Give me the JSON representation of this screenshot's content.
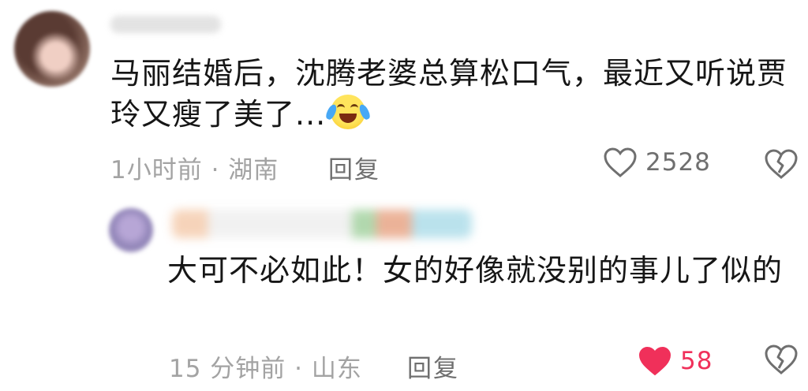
{
  "comments": [
    {
      "text": "马丽结婚后，沈腾老婆总算松口气，最近又听说贾玲又瘦了美了...",
      "emoji": "crying-laughing-emoji",
      "meta": "1小时前 · 湖南",
      "reply_label": "回复",
      "like_count": "2528",
      "liked": false
    },
    {
      "text": "大可不必如此！女的好像就没别的事儿了似的",
      "meta": "15 分钟前 · 山东",
      "reply_label": "回复",
      "like_count": "58",
      "liked": true
    }
  ],
  "colors": {
    "like_active": "#f0305a",
    "meta_gray": "#a3a3a3",
    "icon_gray": "#6f6f6f"
  }
}
